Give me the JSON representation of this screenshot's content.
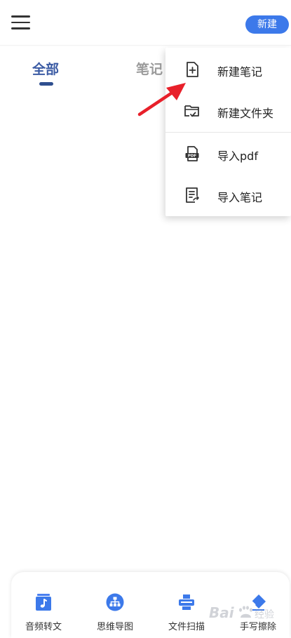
{
  "header": {
    "menu_icon": "hamburger-icon",
    "new_button_label": "新建"
  },
  "tabs": [
    {
      "label": "全部",
      "selected": true
    },
    {
      "label": "笔记",
      "selected": false
    }
  ],
  "popup_menu": {
    "items": [
      {
        "label": "新建笔记",
        "icon": "new-note-icon"
      },
      {
        "label": "新建文件夹",
        "icon": "new-folder-icon"
      },
      {
        "label": "导入pdf",
        "icon": "pdf-icon"
      },
      {
        "label": "导入笔记",
        "icon": "import-note-icon"
      }
    ]
  },
  "bottom_toolbar": {
    "items": [
      {
        "label": "音频转文",
        "icon": "audio-file-icon"
      },
      {
        "label": "思维导图",
        "icon": "mind-map-icon"
      },
      {
        "label": "文件扫描",
        "icon": "scanner-icon"
      },
      {
        "label": "手写擦除",
        "icon": "eraser-icon"
      }
    ]
  },
  "colors": {
    "accent": "#3c79ea",
    "tab_selected": "#3b5ba4",
    "arrow": "#e8202a"
  },
  "watermark": {
    "text": "Bai 经验"
  }
}
